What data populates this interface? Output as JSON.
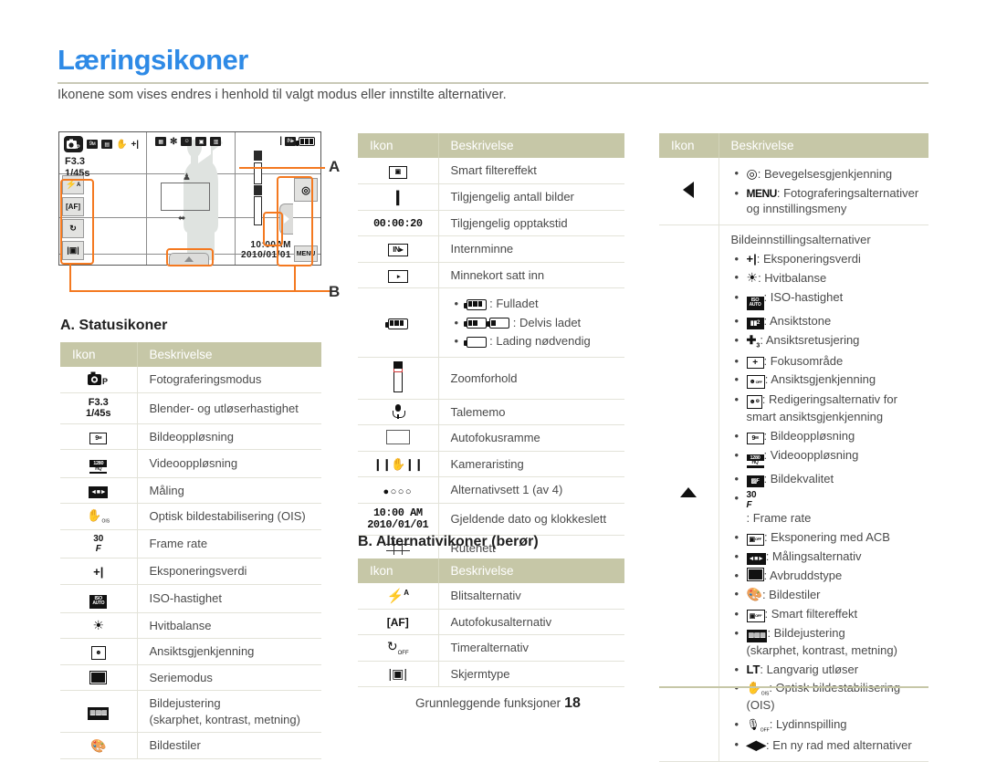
{
  "header": {
    "title": "Læringsikoner",
    "intro": "Ikonene som vises endres i henhold til valgt modus eller innstilte alternativer."
  },
  "lcd": {
    "mode_badge": "P",
    "top_icons": [
      "res-icon",
      "video-res-icon",
      "ois-icon",
      "ev-icon"
    ],
    "mid_icons": [
      "metering-icon",
      "white-balance-icon",
      "face-detect-icon",
      "burst-icon",
      "image-adjust-icon"
    ],
    "exposure": {
      "aperture": "F3.3",
      "shutter": "1/45s"
    },
    "right_icons": [
      "shots-left-icon",
      "internal-memory-icon",
      "battery-icon"
    ],
    "left_buttons": [
      "flash-auto",
      "af-mode",
      "timer-off",
      "display-type"
    ],
    "time": "10:00AM",
    "date": "2010/01/01",
    "menu_button": "MENU",
    "callout_a": "A",
    "callout_b": "B"
  },
  "sections": {
    "a_title": "A. Statusikoner",
    "b_title": "B. Alternativikoner (berør)"
  },
  "table_headers": {
    "icon": "Ikon",
    "description": "Beskrivelse"
  },
  "table_a": [
    {
      "icon": "shooting-mode-icon",
      "desc": "Fotograferingsmodus"
    },
    {
      "icon": "aperture-shutter-icon",
      "icon_text": [
        "F3.3",
        "1/45s"
      ],
      "desc": "Blender- og utløserhastighet"
    },
    {
      "icon": "photo-resolution-icon",
      "icon_text": "9m",
      "desc": "Bildeoppløsning"
    },
    {
      "icon": "video-resolution-icon",
      "icon_text": "1280 HQ",
      "desc": "Videooppløsning"
    },
    {
      "icon": "metering-icon",
      "desc": "Måling"
    },
    {
      "icon": "ois-icon",
      "desc": "Optisk bildestabilisering (OIS)"
    },
    {
      "icon": "frame-rate-icon",
      "icon_text": "30F",
      "desc": "Frame rate"
    },
    {
      "icon": "exposure-value-icon",
      "icon_text": "+",
      "desc": "Eksponeringsverdi"
    },
    {
      "icon": "iso-icon",
      "icon_text": "ISO AUTO",
      "desc": "ISO-hastighet"
    },
    {
      "icon": "white-balance-icon",
      "desc": "Hvitbalanse"
    },
    {
      "icon": "face-detection-icon",
      "desc": "Ansiktsgjenkjenning"
    },
    {
      "icon": "burst-mode-icon",
      "desc": "Seriemodus"
    },
    {
      "icon": "image-adjust-icon",
      "desc": "Bildejustering\n(skarphet, kontrast, metning)"
    },
    {
      "icon": "photo-style-icon",
      "desc": "Bildestiler"
    }
  ],
  "table_mid": [
    {
      "icon": "smart-filter-icon",
      "desc": "Smart filtereffekt"
    },
    {
      "icon": "shots-available-icon",
      "desc": "Tilgjengelig antall bilder"
    },
    {
      "icon": "record-time-icon",
      "icon_text": "00:00:20",
      "desc": "Tilgjengelig opptakstid"
    },
    {
      "icon": "internal-memory-icon",
      "icon_text": "IN",
      "desc": "Internminne"
    },
    {
      "icon": "memory-card-icon",
      "desc": "Minnekort satt inn"
    },
    {
      "icon": "battery-icon",
      "desc_list": [
        {
          "icon": "battery-full-icon",
          "text": ": Fulladet"
        },
        {
          "icon": "battery-partial-icon",
          "text": ": Delvis ladet"
        },
        {
          "icon": "battery-empty-icon",
          "text": ": Lading nødvendig"
        }
      ]
    },
    {
      "icon": "zoom-ratio-icon",
      "desc": "Zoomforhold"
    },
    {
      "icon": "voice-memo-icon",
      "desc": "Talememo"
    },
    {
      "icon": "af-frame-icon",
      "desc": "Autofokusramme"
    },
    {
      "icon": "camera-shake-icon",
      "desc": "Kameraristing"
    },
    {
      "icon": "option-set-icon",
      "desc": "Alternativsett 1 (av 4)"
    },
    {
      "icon": "date-time-icon",
      "icon_text": [
        "10:00 AM",
        "2010/01/01"
      ],
      "desc": "Gjeldende dato og klokkeslett"
    },
    {
      "icon": "grid-icon",
      "desc": "Rutenett"
    }
  ],
  "table_b": [
    {
      "icon": "flash-option-icon",
      "desc": "Blitsalternativ"
    },
    {
      "icon": "af-option-icon",
      "desc": "Autofokusalternativ"
    },
    {
      "icon": "timer-option-icon",
      "desc": "Timeralternativ"
    },
    {
      "icon": "display-type-icon",
      "desc": "Skjermtype"
    }
  ],
  "table_right": [
    {
      "icon": "left-arrow-icon",
      "items": [
        {
          "icon": "motion-recognition-icon",
          "text": ": Bevegelsesgjenkjenning"
        },
        {
          "icon": "menu-icon",
          "label": "MENU",
          "text": ": Fotograferingsalternativer og innstillingsmeny"
        }
      ]
    },
    {
      "icon": "up-arrow-icon",
      "subhead": "Bildeinnstillingsalternativer",
      "items": [
        {
          "icon": "exposure-value-icon",
          "text": ": Eksponeringsverdi"
        },
        {
          "icon": "white-balance-icon",
          "text": ": Hvitbalanse"
        },
        {
          "icon": "iso-icon",
          "text": ": ISO-hastighet"
        },
        {
          "icon": "face-tone-icon",
          "text": ": Ansiktstone"
        },
        {
          "icon": "face-retouch-icon",
          "text": ": Ansiktsretusjering"
        },
        {
          "icon": "focus-area-icon",
          "text": ": Fokusområde"
        },
        {
          "icon": "face-detection-off-icon",
          "text": ": Ansiktsgjenkjenning"
        },
        {
          "icon": "smart-face-edit-icon",
          "text": ": Redigeringsalternativ for smart ansiktsgjenkjenning"
        },
        {
          "icon": "photo-resolution-icon",
          "text": ": Bildeoppløsning"
        },
        {
          "icon": "video-resolution-icon",
          "text": ": Videooppløsning"
        },
        {
          "icon": "photo-quality-icon",
          "text": ": Bildekvalitet"
        },
        {
          "icon": "frame-rate-icon",
          "text": ": Frame rate"
        },
        {
          "icon": "acb-icon",
          "text": ": Eksponering med ACB"
        },
        {
          "icon": "metering-option-icon",
          "text": ": Målingsalternativ"
        },
        {
          "icon": "interrupt-type-icon",
          "text": ": Avbruddstype"
        },
        {
          "icon": "photo-style-icon",
          "text": ": Bildestiler"
        },
        {
          "icon": "smart-filter-off-icon",
          "text": ": Smart filtereffekt"
        },
        {
          "icon": "image-adjust-icon",
          "text": ": Bildejustering\n(skarphet, kontrast, metning)"
        },
        {
          "icon": "long-time-shutter-icon",
          "label": "LT",
          "text": ": Langvarig utløser"
        },
        {
          "icon": "ois-icon",
          "text": ": Optisk bildestabilisering (OIS)"
        },
        {
          "icon": "sound-record-off-icon",
          "text": ": Lydinnspilling"
        },
        {
          "icon": "new-row-icon",
          "text": ": En ny rad med alternativer"
        }
      ]
    }
  ],
  "footer": {
    "label": "Grunnleggende funksjoner",
    "page": "18"
  },
  "colors": {
    "title_blue": "#2e8ae6",
    "table_header": "#c6c7a7",
    "callout_orange": "#f47920"
  }
}
